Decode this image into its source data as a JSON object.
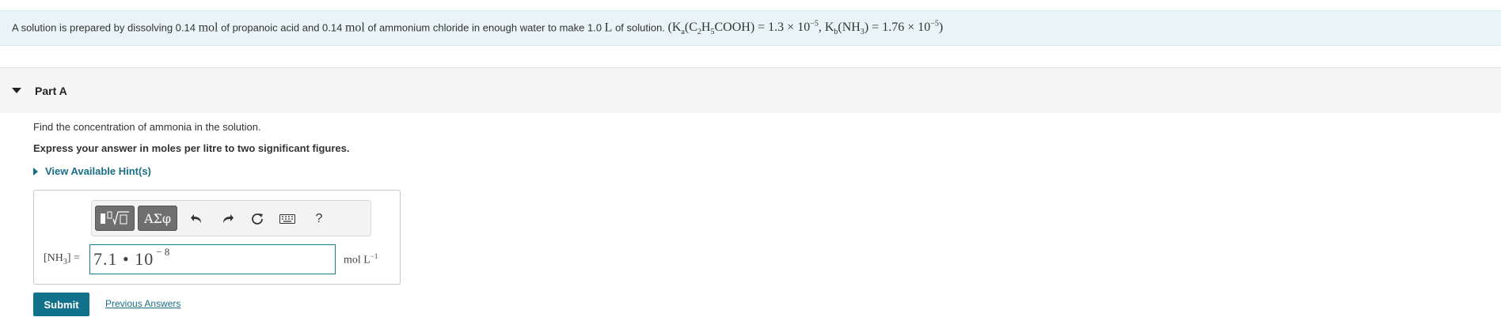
{
  "statement": {
    "text1": "A solution is prepared by dissolving 0.14",
    "unit_mol1": "mol",
    "text2": "of propanoic acid and 0.14",
    "unit_mol2": "mol",
    "text3": "of ammonium chloride in enough water to make 1.0",
    "unit_L": "L",
    "text4": "of solution.",
    "eq_open": "(K",
    "eq_ka_sub": "a",
    "eq_acid": "(C",
    "eq_acid_sub1": "2",
    "eq_acid_mid": "H",
    "eq_acid_sub2": "5",
    "eq_acid_end": "COOH) = 1.3 × 10",
    "eq_ka_exp": "−5",
    "eq_sep": ", K",
    "eq_kb_sub": "b",
    "eq_base": "(NH",
    "eq_base_sub": "3",
    "eq_base_end": ") = 1.76 × 10",
    "eq_kb_exp": "−5",
    "eq_close": ")"
  },
  "part": {
    "title": "Part A"
  },
  "question": "Find the concentration of ammonia in the solution.",
  "instruction": "Express your answer in moles per litre to two significant figures.",
  "hints_label": "View Available Hint(s)",
  "toolbar": {
    "greek_label": "ΑΣφ",
    "help_label": "?"
  },
  "answer": {
    "label_main": "[NH",
    "label_sub": "3",
    "label_end": "] =",
    "value": "7.1 • 10",
    "exponent": "− 8",
    "unit_main": "mol L",
    "unit_exp": "−1"
  },
  "submit_label": "Submit",
  "previous_answers_label": "Previous Answers",
  "colors": {
    "accent": "#12728c",
    "link": "#1a6e86",
    "banner_bg": "#e8f4f5"
  }
}
